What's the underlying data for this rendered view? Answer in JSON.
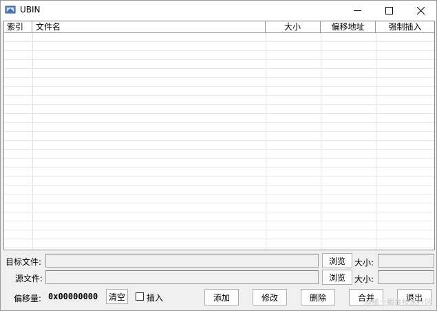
{
  "window": {
    "title": "UBIN",
    "icon": "app-icon",
    "controls": {
      "minimize": "—",
      "maximize": "☐",
      "close": "✕"
    }
  },
  "list": {
    "columns": [
      "索引",
      "文件名",
      "大小",
      "偏移地址",
      "强制插入"
    ],
    "rows": []
  },
  "form": {
    "target_label": "目标文件:",
    "target_value": "",
    "source_label": "源文件:",
    "source_value": "",
    "browse_label": "浏览",
    "size_label": "大小:",
    "offset_label": "偏移量:",
    "offset_value": "0x00000000",
    "clear_label": "清空",
    "insert_label": "插入",
    "insert_checked": false
  },
  "actions": {
    "add": "添加",
    "modify": "修改",
    "delete": "删除",
    "merge": "合并",
    "exit": "退出"
  },
  "watermark": "@稀土掘金技术社区"
}
